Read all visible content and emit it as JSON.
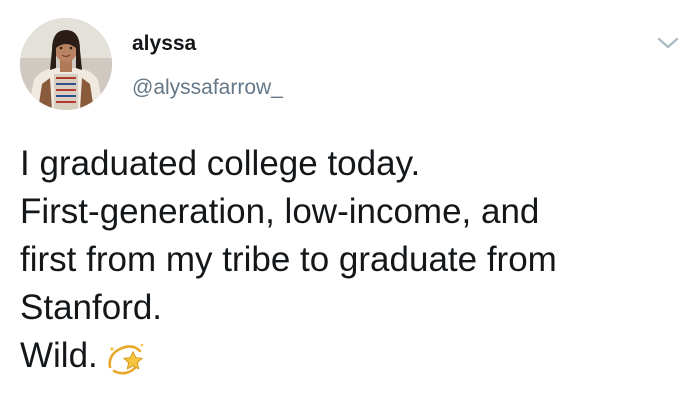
{
  "user": {
    "display_name": "alyssa",
    "handle": "@alyssafarrow_",
    "avatar_icon": "profile-photo"
  },
  "menu": {
    "icon": "chevron-down-icon"
  },
  "tweet": {
    "lines": [
      "I graduated college today.",
      "First-generation, low-income, and",
      "first from my tribe to graduate from",
      "Stanford.",
      "Wild."
    ],
    "emoji_icon": "dizzy-star-emoji"
  },
  "colors": {
    "text": "#14171a",
    "secondary_text": "#657786",
    "chevron": "#aab8c2",
    "emoji_gold": "#f5c542"
  }
}
